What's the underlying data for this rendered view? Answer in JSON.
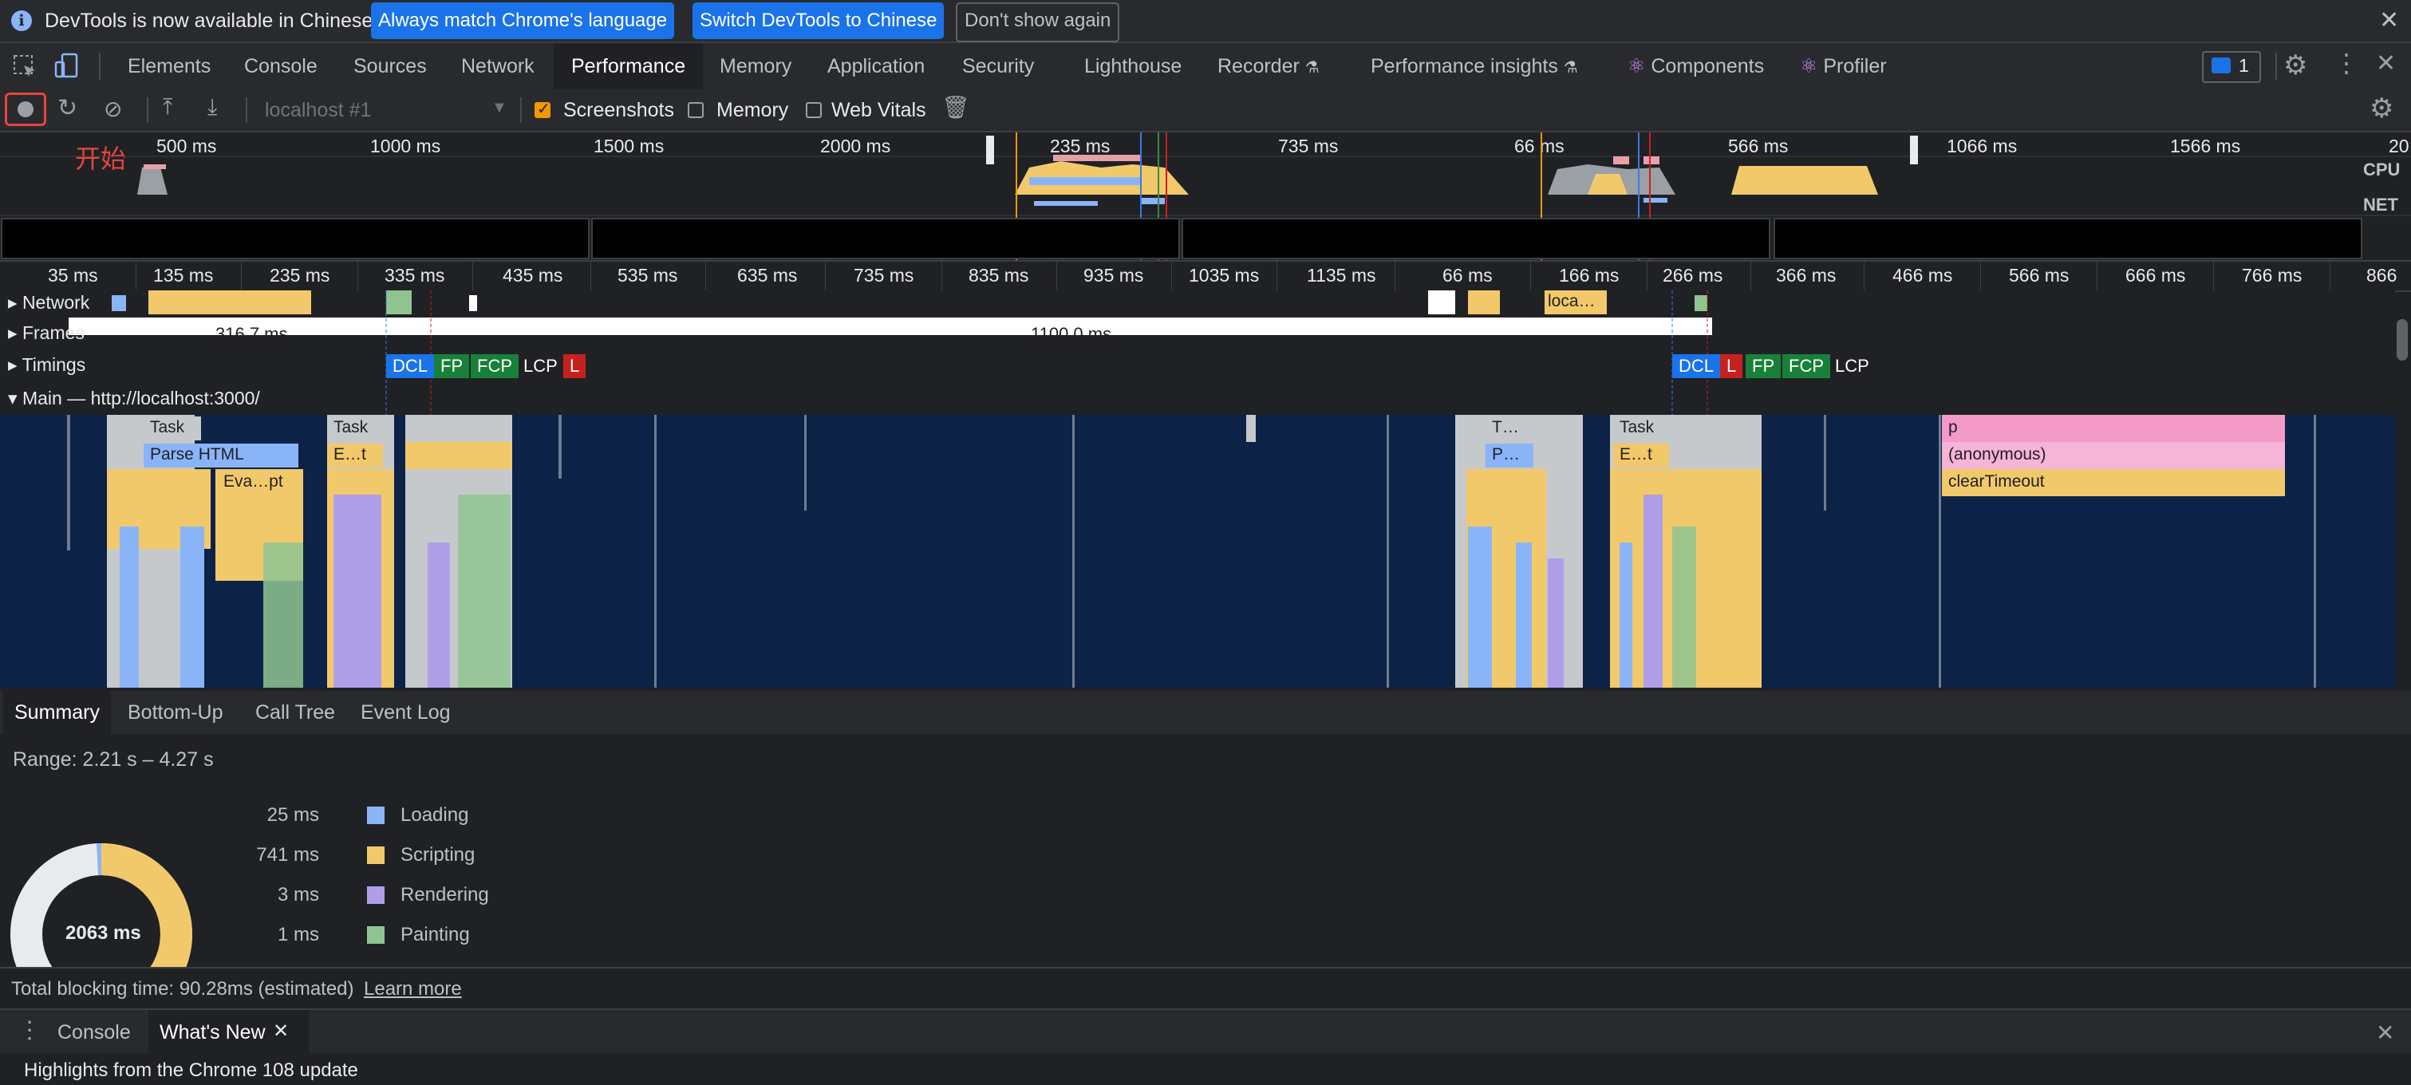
{
  "infobar": {
    "message": "DevTools is now available in Chinese!",
    "btn_match": "Always match Chrome's language",
    "btn_switch": "Switch DevTools to Chinese",
    "btn_dont_show": "Don't show again"
  },
  "tabs": [
    "Elements",
    "Console",
    "Sources",
    "Network",
    "Performance",
    "Memory",
    "Application",
    "Security",
    "Lighthouse",
    "Recorder",
    "Performance insights",
    "Components",
    "Profiler"
  ],
  "active_tab": "Performance",
  "issues_count": "1",
  "perf_toolbar": {
    "target": "localhost #1",
    "screenshots_label": "Screenshots",
    "screenshots_checked": true,
    "memory_label": "Memory",
    "memory_checked": false,
    "webvitals_label": "Web Vitals",
    "webvitals_checked": false
  },
  "annotation": "开始",
  "overview": {
    "ticks": [
      "500 ms",
      "1000 ms",
      "1500 ms",
      "2000 ms",
      "235 ms",
      "735 ms",
      "66 ms",
      "566 ms",
      "1066 ms",
      "1566 ms",
      "20"
    ],
    "cpu_label": "CPU",
    "net_label": "NET"
  },
  "ruler_ticks": [
    "35 ms",
    "135 ms",
    "235 ms",
    "335 ms",
    "435 ms",
    "535 ms",
    "635 ms",
    "735 ms",
    "835 ms",
    "935 ms",
    "1035 ms",
    "1135 ms",
    "66 ms",
    "166 ms",
    "266 ms",
    "366 ms",
    "466 ms",
    "566 ms",
    "666 ms",
    "766 ms",
    "866"
  ],
  "tracks": {
    "network": "Network",
    "network_block_label": "loca…",
    "frames": "Frames",
    "frame1": "316.7 ms",
    "frame2": "1100.0 ms",
    "timings": "Timings",
    "timing_markers_1": [
      "DCL",
      "FP",
      "FCP",
      "LCP",
      "L"
    ],
    "timing_markers_2": [
      "DCL",
      "L",
      "FP",
      "FCP",
      "LCP"
    ],
    "main": "Main — http://localhost:3000/"
  },
  "flame_labels": {
    "task1": "Task",
    "task2": "Task",
    "parse_html": "Parse HTML",
    "et1": "E…t",
    "eval": "Eva…pt",
    "t3": "T…",
    "p3": "P…",
    "task4": "Task",
    "et4": "E…t",
    "p": "p",
    "anonymous": "(anonymous)",
    "clear_timeout": "clearTimeout"
  },
  "summary_tabs": [
    "Summary",
    "Bottom-Up",
    "Call Tree",
    "Event Log"
  ],
  "summary": {
    "range": "Range: 2.21 s – 4.27 s",
    "total": "2063 ms",
    "legend": [
      {
        "value": "25 ms",
        "label": "Loading",
        "color": "#8ab4f8"
      },
      {
        "value": "741 ms",
        "label": "Scripting",
        "color": "#f2c96a"
      },
      {
        "value": "3 ms",
        "label": "Rendering",
        "color": "#af9ee8"
      },
      {
        "value": "1 ms",
        "label": "Painting",
        "color": "#8fc491"
      }
    ],
    "tbt": "Total blocking time: 90.28ms (estimated)",
    "learn_more": "Learn more"
  },
  "drawer": {
    "tabs": [
      "Console",
      "What's New"
    ],
    "active": "What's New",
    "headline": "Highlights from the Chrome 108 update"
  },
  "colors": {
    "record_highlight": "#e8453c",
    "scripting": "#f2c96a",
    "loading": "#8ab4f8",
    "rendering": "#af9ee8",
    "painting": "#8fc491",
    "flame_bg": "#0d2247"
  }
}
